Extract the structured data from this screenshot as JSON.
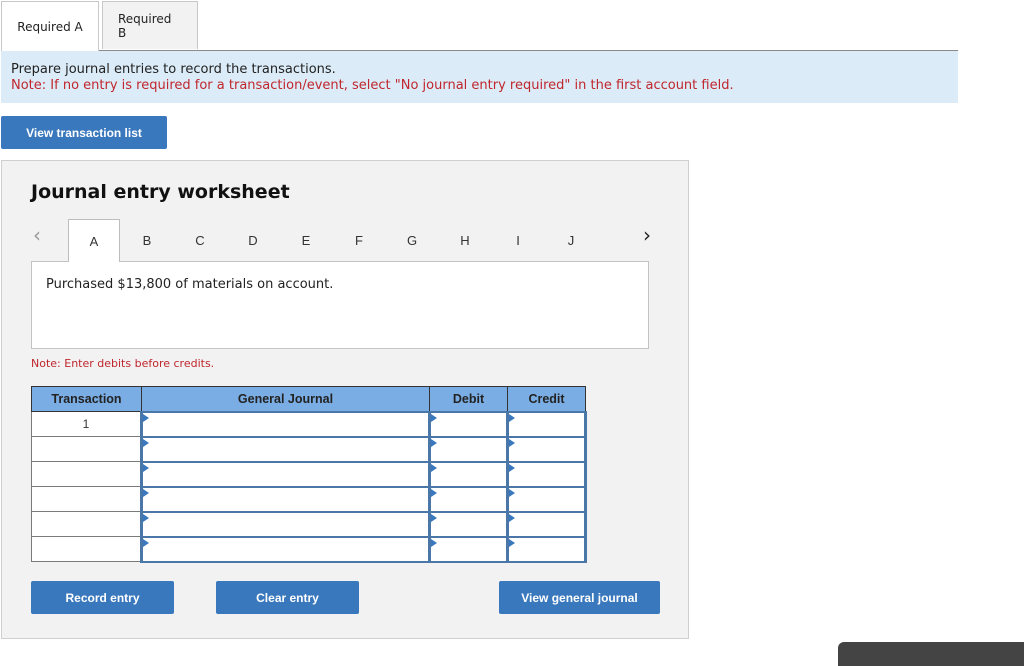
{
  "tabs": [
    {
      "label": "Required A",
      "active": true
    },
    {
      "label": "Required B",
      "active": false
    }
  ],
  "instructions": {
    "main": "Prepare journal entries to record the transactions.",
    "note": "Note: If no entry is required for a transaction/event, select \"No journal entry required\" in the first account field."
  },
  "buttons": {
    "view_transaction_list": "View transaction list",
    "record_entry": "Record entry",
    "clear_entry": "Clear entry",
    "view_general_journal": "View general journal"
  },
  "worksheet": {
    "title": "Journal entry worksheet",
    "nav_prev_icon": "chevron-left",
    "nav_next_icon": "chevron-right",
    "letters": [
      "A",
      "B",
      "C",
      "D",
      "E",
      "F",
      "G",
      "H",
      "I",
      "J"
    ],
    "active_letter": "A",
    "description": "Purchased $13,800 of materials on account.",
    "note": "Note: Enter debits before credits."
  },
  "journal_table": {
    "headers": [
      "Transaction",
      "General Journal",
      "Debit",
      "Credit"
    ],
    "rows": [
      {
        "transaction": "1",
        "account": "",
        "debit": "",
        "credit": ""
      },
      {
        "transaction": "",
        "account": "",
        "debit": "",
        "credit": ""
      },
      {
        "transaction": "",
        "account": "",
        "debit": "",
        "credit": ""
      },
      {
        "transaction": "",
        "account": "",
        "debit": "",
        "credit": ""
      },
      {
        "transaction": "",
        "account": "",
        "debit": "",
        "credit": ""
      },
      {
        "transaction": "",
        "account": "",
        "debit": "",
        "credit": ""
      }
    ]
  },
  "colors": {
    "accent": "#3a78bd",
    "header_blue": "#7aade3",
    "note_red": "#c0262d",
    "instruction_bg": "#dbecf8"
  }
}
